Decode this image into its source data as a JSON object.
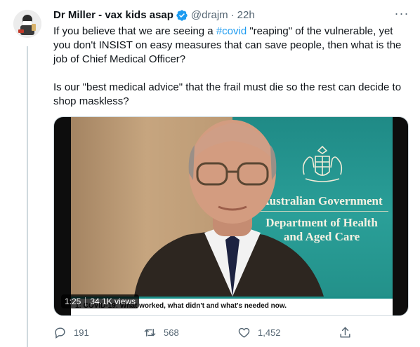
{
  "tweet": {
    "display_name": "Dr Miller - vax kids asap",
    "handle": "@drajm",
    "separator": "·",
    "time": "22h",
    "more_label": "···",
    "text_part1": "If you believe that we are seeing a ",
    "hashtag": "#covid",
    "text_part2": " \"reaping\" of the vulnerable, yet you don't INSIST on easy  measures that can save people, then what is the job of Chief Medical Officer?",
    "text_para2": "Is our \"best medical advice\" that the frail must die so the rest can decide to shop maskless?"
  },
  "media": {
    "duration": "1:25",
    "views": "34.1K views",
    "caption": "1: COVID-19: What worked, what didn't and what's needed now.",
    "backdrop": {
      "line1": "Australian Government",
      "line2": "Department of Health",
      "line3": "and Aged Care"
    }
  },
  "actions": {
    "replies": "191",
    "retweets": "568",
    "likes": "1,452"
  },
  "colors": {
    "accent": "#1d9bf0",
    "secondary_text": "#536471",
    "primary_text": "#0f1419"
  }
}
